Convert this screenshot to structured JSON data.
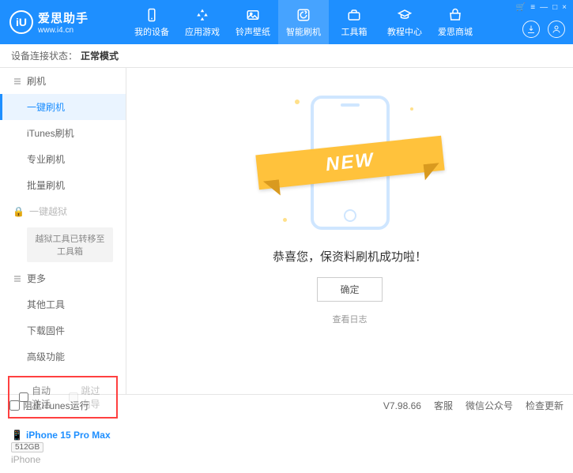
{
  "app": {
    "title": "爱思助手",
    "subtitle": "www.i4.cn",
    "logo_letter": "iU"
  },
  "window_controls": {
    "cart": "🛒",
    "menu": "≡",
    "min": "—",
    "max": "□",
    "close": "×"
  },
  "nav": [
    {
      "label": "我的设备"
    },
    {
      "label": "应用游戏"
    },
    {
      "label": "铃声壁纸"
    },
    {
      "label": "智能刷机"
    },
    {
      "label": "工具箱"
    },
    {
      "label": "教程中心"
    },
    {
      "label": "爱思商城"
    }
  ],
  "status": {
    "label": "设备连接状态：",
    "value": "正常模式"
  },
  "sidebar": {
    "group_refresh": "刷机",
    "items": [
      "一键刷机",
      "iTunes刷机",
      "专业刷机",
      "批量刷机"
    ],
    "group_jailbreak": "一键越狱",
    "transfer_note": "越狱工具已转移至工具箱",
    "group_more": "更多",
    "more_items": [
      "其他工具",
      "下载固件",
      "高级功能"
    ]
  },
  "checks": {
    "auto_activate": "自动激活",
    "skip_guide": "跳过向导"
  },
  "device": {
    "name": "iPhone 15 Pro Max",
    "storage": "512GB",
    "type": "iPhone"
  },
  "main": {
    "ribbon": "NEW",
    "message": "恭喜您，保资料刷机成功啦！",
    "ok": "确定",
    "view_log": "查看日志"
  },
  "footer": {
    "block_itunes": "阻止iTunes运行",
    "version": "V7.98.66",
    "links": [
      "客服",
      "微信公众号",
      "检查更新"
    ]
  }
}
